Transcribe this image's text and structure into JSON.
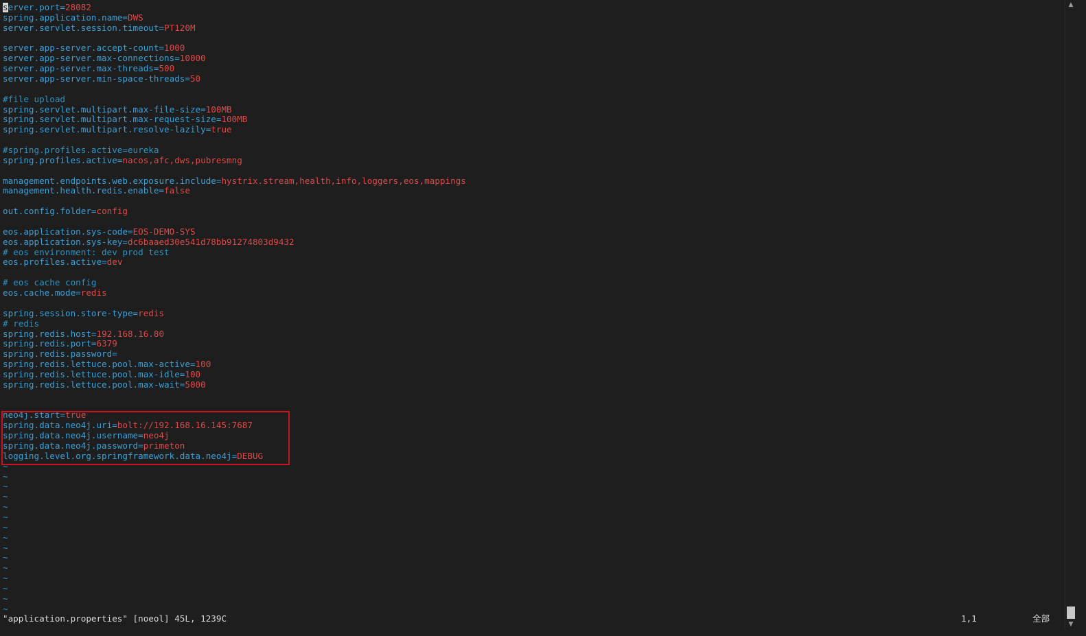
{
  "editor": {
    "lines": [
      {
        "parts": [
          {
            "text": "s",
            "cls": "k cursor"
          },
          {
            "text": "erver.port=",
            "cls": "k"
          },
          {
            "text": "28082",
            "cls": "v"
          }
        ]
      },
      {
        "parts": [
          {
            "text": "spring.application.name=",
            "cls": "k"
          },
          {
            "text": "DWS",
            "cls": "v"
          }
        ]
      },
      {
        "parts": [
          {
            "text": "server.servlet.session.timeout=",
            "cls": "k"
          },
          {
            "text": "PT120M",
            "cls": "v"
          }
        ]
      },
      {
        "parts": []
      },
      {
        "parts": [
          {
            "text": "server.app-server.accept-count=",
            "cls": "k"
          },
          {
            "text": "1000",
            "cls": "v"
          }
        ]
      },
      {
        "parts": [
          {
            "text": "server.app-server.max-connections=",
            "cls": "k"
          },
          {
            "text": "10000",
            "cls": "v"
          }
        ]
      },
      {
        "parts": [
          {
            "text": "server.app-server.max-threads=",
            "cls": "k"
          },
          {
            "text": "500",
            "cls": "v"
          }
        ]
      },
      {
        "parts": [
          {
            "text": "server.app-server.min-space-threads=",
            "cls": "k"
          },
          {
            "text": "50",
            "cls": "v"
          }
        ]
      },
      {
        "parts": []
      },
      {
        "parts": [
          {
            "text": "#file upload",
            "cls": "c"
          }
        ]
      },
      {
        "parts": [
          {
            "text": "spring.servlet.multipart.max-file-size=",
            "cls": "k"
          },
          {
            "text": "100MB",
            "cls": "v"
          }
        ]
      },
      {
        "parts": [
          {
            "text": "spring.servlet.multipart.max-request-size=",
            "cls": "k"
          },
          {
            "text": "100MB",
            "cls": "v"
          }
        ]
      },
      {
        "parts": [
          {
            "text": "spring.servlet.multipart.resolve-lazily=",
            "cls": "k"
          },
          {
            "text": "true",
            "cls": "v"
          }
        ]
      },
      {
        "parts": []
      },
      {
        "parts": [
          {
            "text": "#spring.profiles.active=eureka",
            "cls": "c"
          }
        ]
      },
      {
        "parts": [
          {
            "text": "spring.profiles.active=",
            "cls": "k"
          },
          {
            "text": "nacos,afc,dws,pubresmng",
            "cls": "v"
          }
        ]
      },
      {
        "parts": []
      },
      {
        "parts": [
          {
            "text": "management.endpoints.web.exposure.include=",
            "cls": "k"
          },
          {
            "text": "hystrix.stream,health,info,loggers,eos,mappings",
            "cls": "v"
          }
        ]
      },
      {
        "parts": [
          {
            "text": "management.health.redis.enable=",
            "cls": "k"
          },
          {
            "text": "false",
            "cls": "v"
          }
        ]
      },
      {
        "parts": []
      },
      {
        "parts": [
          {
            "text": "out.config.folder=",
            "cls": "k"
          },
          {
            "text": "config",
            "cls": "v"
          }
        ]
      },
      {
        "parts": []
      },
      {
        "parts": [
          {
            "text": "eos.application.sys-code=",
            "cls": "k"
          },
          {
            "text": "EOS-DEMO-SYS",
            "cls": "v"
          }
        ]
      },
      {
        "parts": [
          {
            "text": "eos.application.sys-key=",
            "cls": "k"
          },
          {
            "text": "dc6baaed30e541d78bb91274803d9432",
            "cls": "v"
          }
        ]
      },
      {
        "parts": [
          {
            "text": "# eos environment: dev prod test",
            "cls": "c"
          }
        ]
      },
      {
        "parts": [
          {
            "text": "eos.profiles.active=",
            "cls": "k"
          },
          {
            "text": "dev",
            "cls": "v"
          }
        ]
      },
      {
        "parts": []
      },
      {
        "parts": [
          {
            "text": "# eos cache config",
            "cls": "c"
          }
        ]
      },
      {
        "parts": [
          {
            "text": "eos.cache.mode=",
            "cls": "k"
          },
          {
            "text": "redis",
            "cls": "v"
          }
        ]
      },
      {
        "parts": []
      },
      {
        "parts": [
          {
            "text": "spring.session.store-type=",
            "cls": "k"
          },
          {
            "text": "redis",
            "cls": "v"
          }
        ]
      },
      {
        "parts": [
          {
            "text": "# redis",
            "cls": "c"
          }
        ]
      },
      {
        "parts": [
          {
            "text": "spring.redis.host=",
            "cls": "k"
          },
          {
            "text": "192.168.16.80",
            "cls": "v"
          }
        ]
      },
      {
        "parts": [
          {
            "text": "spring.redis.port=",
            "cls": "k"
          },
          {
            "text": "6379",
            "cls": "v"
          }
        ]
      },
      {
        "parts": [
          {
            "text": "spring.redis.password=",
            "cls": "k"
          }
        ]
      },
      {
        "parts": [
          {
            "text": "spring.redis.lettuce.pool.max-active=",
            "cls": "k"
          },
          {
            "text": "100",
            "cls": "v"
          }
        ]
      },
      {
        "parts": [
          {
            "text": "spring.redis.lettuce.pool.max-idle=",
            "cls": "k"
          },
          {
            "text": "100",
            "cls": "v"
          }
        ]
      },
      {
        "parts": [
          {
            "text": "spring.redis.lettuce.pool.max-wait=",
            "cls": "k"
          },
          {
            "text": "5000",
            "cls": "v"
          }
        ]
      },
      {
        "parts": []
      },
      {
        "parts": []
      },
      {
        "parts": [
          {
            "text": "neo4j.start=",
            "cls": "k"
          },
          {
            "text": "true",
            "cls": "v"
          }
        ]
      },
      {
        "parts": [
          {
            "text": "spring.data.neo4j.uri=",
            "cls": "k"
          },
          {
            "text": "bolt://192.168.16.145:7687",
            "cls": "v"
          }
        ]
      },
      {
        "parts": [
          {
            "text": "spring.data.neo4j.username=",
            "cls": "k"
          },
          {
            "text": "neo4j",
            "cls": "v"
          }
        ]
      },
      {
        "parts": [
          {
            "text": "spring.data.neo4j.password=",
            "cls": "k"
          },
          {
            "text": "primeton",
            "cls": "v"
          }
        ]
      },
      {
        "parts": [
          {
            "text": "logging.level.org.springframework.data.neo4j=",
            "cls": "k"
          },
          {
            "text": "DEBUG",
            "cls": "v"
          }
        ]
      },
      {
        "parts": [
          {
            "text": "~",
            "cls": "t"
          }
        ]
      },
      {
        "parts": [
          {
            "text": "~",
            "cls": "t"
          }
        ]
      },
      {
        "parts": [
          {
            "text": "~",
            "cls": "t"
          }
        ]
      },
      {
        "parts": [
          {
            "text": "~",
            "cls": "t"
          }
        ]
      },
      {
        "parts": [
          {
            "text": "~",
            "cls": "t"
          }
        ]
      },
      {
        "parts": [
          {
            "text": "~",
            "cls": "t"
          }
        ]
      },
      {
        "parts": [
          {
            "text": "~",
            "cls": "t"
          }
        ]
      },
      {
        "parts": [
          {
            "text": "~",
            "cls": "t"
          }
        ]
      },
      {
        "parts": [
          {
            "text": "~",
            "cls": "t"
          }
        ]
      },
      {
        "parts": [
          {
            "text": "~",
            "cls": "t"
          }
        ]
      },
      {
        "parts": [
          {
            "text": "~",
            "cls": "t"
          }
        ]
      },
      {
        "parts": [
          {
            "text": "~",
            "cls": "t"
          }
        ]
      },
      {
        "parts": [
          {
            "text": "~",
            "cls": "t"
          }
        ]
      },
      {
        "parts": [
          {
            "text": "~",
            "cls": "t"
          }
        ]
      },
      {
        "parts": [
          {
            "text": "~",
            "cls": "t"
          }
        ]
      }
    ]
  },
  "statusbar": {
    "file_info": "\"application.properties\" [noeol] 45L, 1239C",
    "cursor_position": "1,1",
    "view_position": "全部"
  },
  "icons": {
    "scroll_up": "scroll-up-arrow-icon",
    "scroll_down": "scroll-down-arrow-icon"
  },
  "colors": {
    "background": "#1e1e1e",
    "key": "#3aa0d8",
    "value": "#e04848",
    "comment": "#2e93c0",
    "highlight_border": "#c8141e"
  }
}
